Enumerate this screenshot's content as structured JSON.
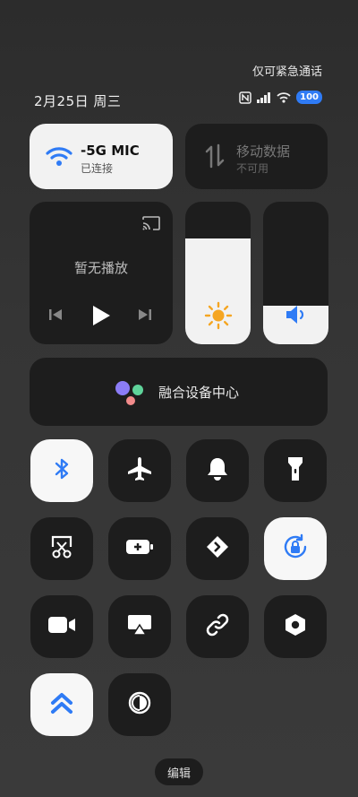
{
  "header": {
    "emergency_text": "仅可紧急通话",
    "date_text": "2月25日 周三",
    "battery_level": "100"
  },
  "wifi": {
    "name": "-5G    MIC",
    "status": "已连接"
  },
  "mobile_data": {
    "name": "移动数据",
    "status": "不可用"
  },
  "media": {
    "title": "暂无播放"
  },
  "brightness": {
    "level_percent": 74
  },
  "volume": {
    "level_percent": 27
  },
  "fusion": {
    "label": "融合设备中心"
  },
  "toggles": [
    {
      "name": "bluetooth",
      "state": "on"
    },
    {
      "name": "airplane-mode",
      "state": "off"
    },
    {
      "name": "ring-mode",
      "state": "off"
    },
    {
      "name": "flashlight",
      "state": "off"
    },
    {
      "name": "screenshot",
      "state": "off"
    },
    {
      "name": "battery-saver",
      "state": "off"
    },
    {
      "name": "nfc-transfer",
      "state": "off"
    },
    {
      "name": "rotation-lock",
      "state": "on"
    },
    {
      "name": "screen-record",
      "state": "off"
    },
    {
      "name": "screen-cast",
      "state": "off"
    },
    {
      "name": "link-sharing",
      "state": "off"
    },
    {
      "name": "settings-hex",
      "state": "off"
    },
    {
      "name": "super-mode",
      "state": "on"
    },
    {
      "name": "dark-mode",
      "state": "off"
    }
  ],
  "edit_label": "编辑",
  "colors": {
    "accent_blue": "#2f7bf5",
    "sun_orange": "#f5a623"
  }
}
